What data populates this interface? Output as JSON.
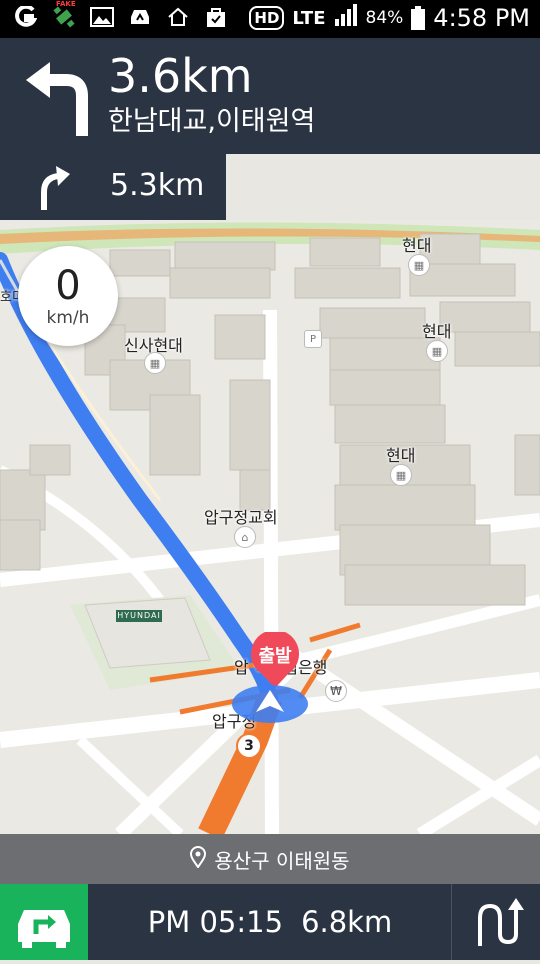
{
  "status_bar": {
    "icons": [
      "g-icon",
      "satellite-fake-gps-icon",
      "gallery-icon",
      "car-icon",
      "home-icon",
      "shopping-bag-icon"
    ],
    "hd": "HD",
    "network": "LTE",
    "battery": "84%",
    "time": "4:58 PM"
  },
  "guidance": {
    "main_distance": "3.6km",
    "main_road": "한남대교,이태원역",
    "next_distance": "5.3km"
  },
  "speed": {
    "value": "0",
    "unit": "km/h"
  },
  "map": {
    "labels": {
      "hyundai_1": "현대",
      "hyundai_2": "현대",
      "hyundai_3": "현대",
      "sinsa_hyundai": "신사현대",
      "apgujeong_church": "압구정교회",
      "bank": "압 역산업은행",
      "station": "압구정",
      "left_edge": "호미동",
      "fake_label": "FAKE"
    },
    "start_marker": "출발",
    "route_number": "3",
    "hyundai_sign": "HYUNDAI"
  },
  "location": {
    "text": "용산구 이태원동"
  },
  "bottom": {
    "eta_time": "PM 05:15",
    "remaining": "6.8km"
  },
  "colors": {
    "panel": "#2b3442",
    "route_blue": "#3f7ef0",
    "route_orange": "#f07a2e",
    "accent_green": "#19b35c",
    "start_red": "#f04a5a"
  }
}
